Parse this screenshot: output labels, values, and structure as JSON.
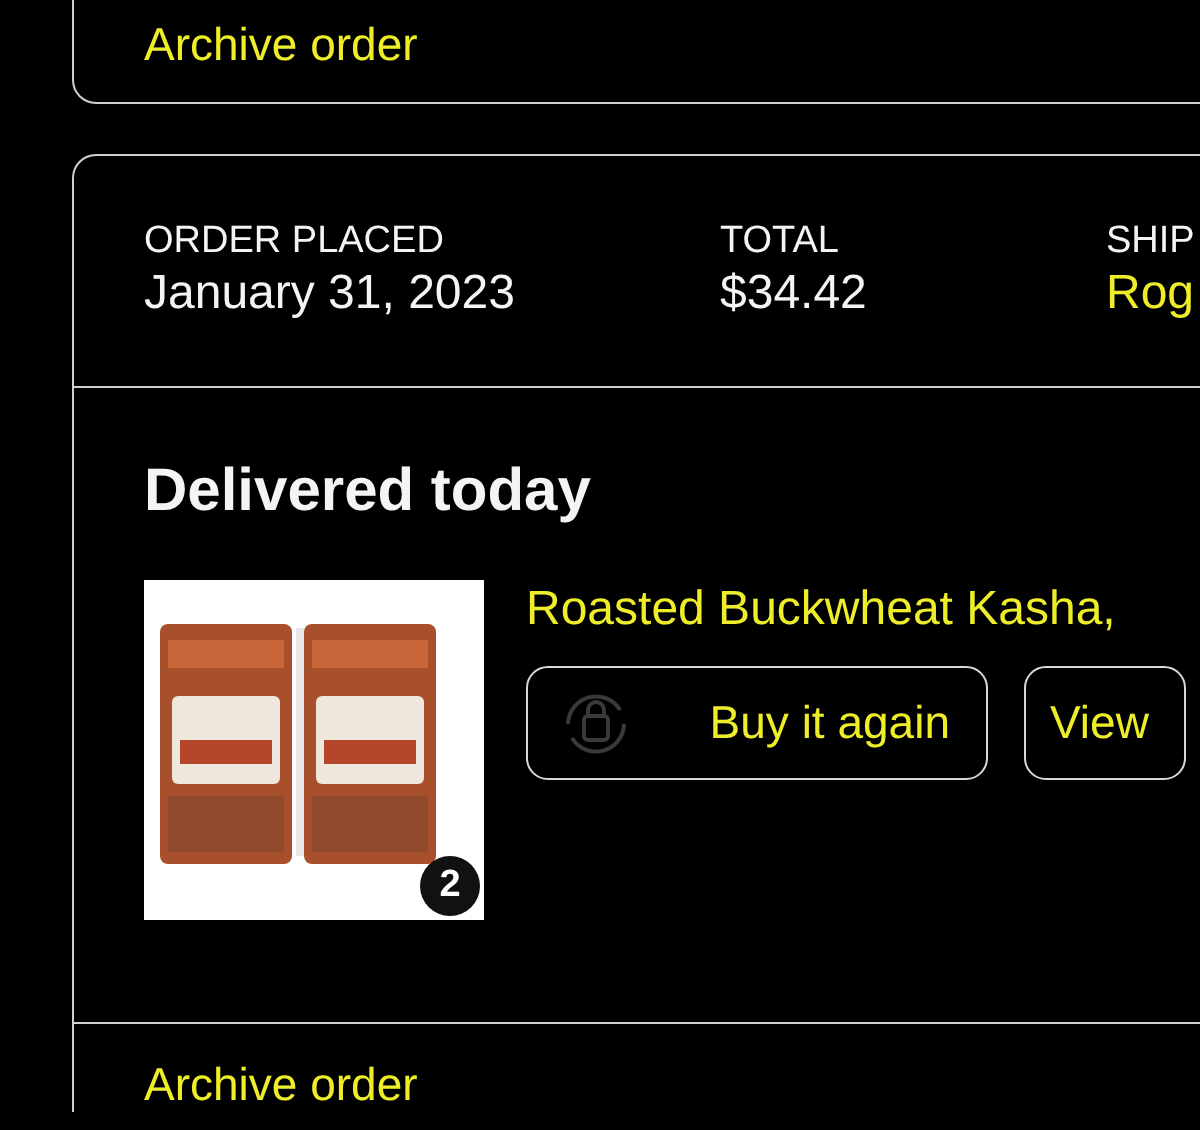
{
  "previous_order": {
    "action": "Archive order"
  },
  "order": {
    "summary": [
      {
        "label": "ORDER PLACED",
        "value": "January 31, 2023",
        "kind": "text"
      },
      {
        "label": "TOTAL",
        "value": "$34.42",
        "kind": "text"
      },
      {
        "label": "SHIP",
        "value": "Rog",
        "kind": "link"
      }
    ],
    "status": "Delivered today",
    "items": [
      {
        "image": {
          "kind": "picture"
        },
        "quantity": "2",
        "title": "Roasted Buckwheat Kasha,",
        "buttons": [
          {
            "label": "Buy it again",
            "kind": "reorder"
          },
          {
            "label": "View",
            "kind": "plain"
          }
        ]
      }
    ],
    "action": "Archive order"
  }
}
